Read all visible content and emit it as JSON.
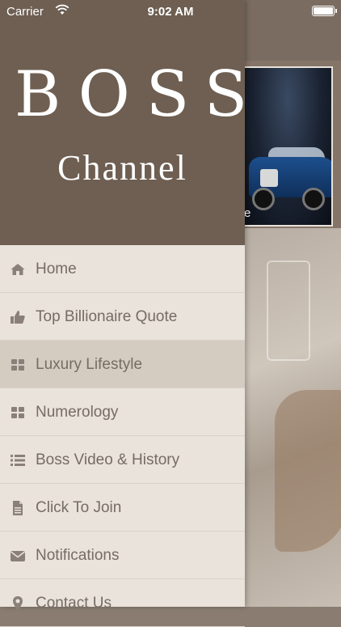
{
  "status_bar": {
    "carrier": "Carrier",
    "time": "9:02 AM"
  },
  "drawer": {
    "logo_title": "BOSS",
    "logo_subtitle": "Channel",
    "items": [
      {
        "label": "Home",
        "icon": "home-icon"
      },
      {
        "label": "Top Billionaire Quote",
        "icon": "thumbs-up-icon"
      },
      {
        "label": "Luxury Lifestyle",
        "icon": "grid-icon",
        "active": true
      },
      {
        "label": "Numerology",
        "icon": "grid-icon"
      },
      {
        "label": "Boss Video & History",
        "icon": "list-icon"
      },
      {
        "label": "Click To Join",
        "icon": "document-icon"
      },
      {
        "label": "Notifications",
        "icon": "envelope-icon"
      },
      {
        "label": "Contact Us",
        "icon": "location-pin-icon"
      }
    ]
  },
  "background": {
    "card_caption": "e"
  },
  "colors": {
    "header_bg": "#6e5f52",
    "menu_bg": "#e9e3dc",
    "active_bg": "#d4ccc1",
    "menu_text": "#766c63"
  }
}
